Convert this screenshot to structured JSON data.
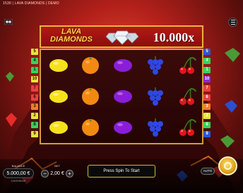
{
  "window_title": "1530 | LAVA DIAMONDS | DEMO",
  "banner": {
    "logo_line1": "LAVA",
    "logo_line2": "DIAMONDS",
    "multiplier": "10.000x"
  },
  "paylines_left": [
    {
      "num": "5",
      "color": "#e9e33b"
    },
    {
      "num": "4",
      "color": "#37d25a"
    },
    {
      "num": "1",
      "color": "#37d25a"
    },
    {
      "num": "10",
      "color": "#e9e33b"
    },
    {
      "num": "7",
      "color": "#e84040"
    },
    {
      "num": "6",
      "color": "#e84040"
    },
    {
      "num": "3",
      "color": "#f27e24"
    },
    {
      "num": "2",
      "color": "#e9e33b"
    },
    {
      "num": "8",
      "color": "#37d25a"
    },
    {
      "num": "9",
      "color": "#e9e33b"
    }
  ],
  "paylines_right": [
    {
      "num": "5",
      "color": "#2b56d8"
    },
    {
      "num": "4",
      "color": "#37d25a"
    },
    {
      "num": "1",
      "color": "#37d25a"
    },
    {
      "num": "10",
      "color": "#8a2bd8"
    },
    {
      "num": "7",
      "color": "#e84040"
    },
    {
      "num": "6",
      "color": "#e84040"
    },
    {
      "num": "3",
      "color": "#f27e24"
    },
    {
      "num": "2",
      "color": "#e9e33b"
    },
    {
      "num": "8",
      "color": "#37d25a"
    },
    {
      "num": "9",
      "color": "#2b56d8"
    }
  ],
  "reels": [
    [
      "lemon",
      "lemon",
      "lemon"
    ],
    [
      "orange",
      "orange",
      "orange"
    ],
    [
      "plum",
      "plum",
      "plum"
    ],
    [
      "grapes",
      "grapes",
      "grapes"
    ],
    [
      "cherries",
      "cherries",
      "cherries"
    ]
  ],
  "balance": {
    "label": "BALANCE",
    "value": "5.000,00 €",
    "sub": "CASH/EUR"
  },
  "bet": {
    "label": "BET",
    "value": "2,00 €",
    "minus": "−",
    "plus": "+"
  },
  "spin_prompt": "Press Spin To Start",
  "auto_label": "AUTO",
  "icons": {
    "logo": "game-logo-icon",
    "menu": "hamburger-menu-icon",
    "spin": "spin-icon"
  },
  "colors": {
    "accent_gold": "#e2b43c",
    "banner_red": "#b51815",
    "reel_bg": "#2b0606"
  }
}
